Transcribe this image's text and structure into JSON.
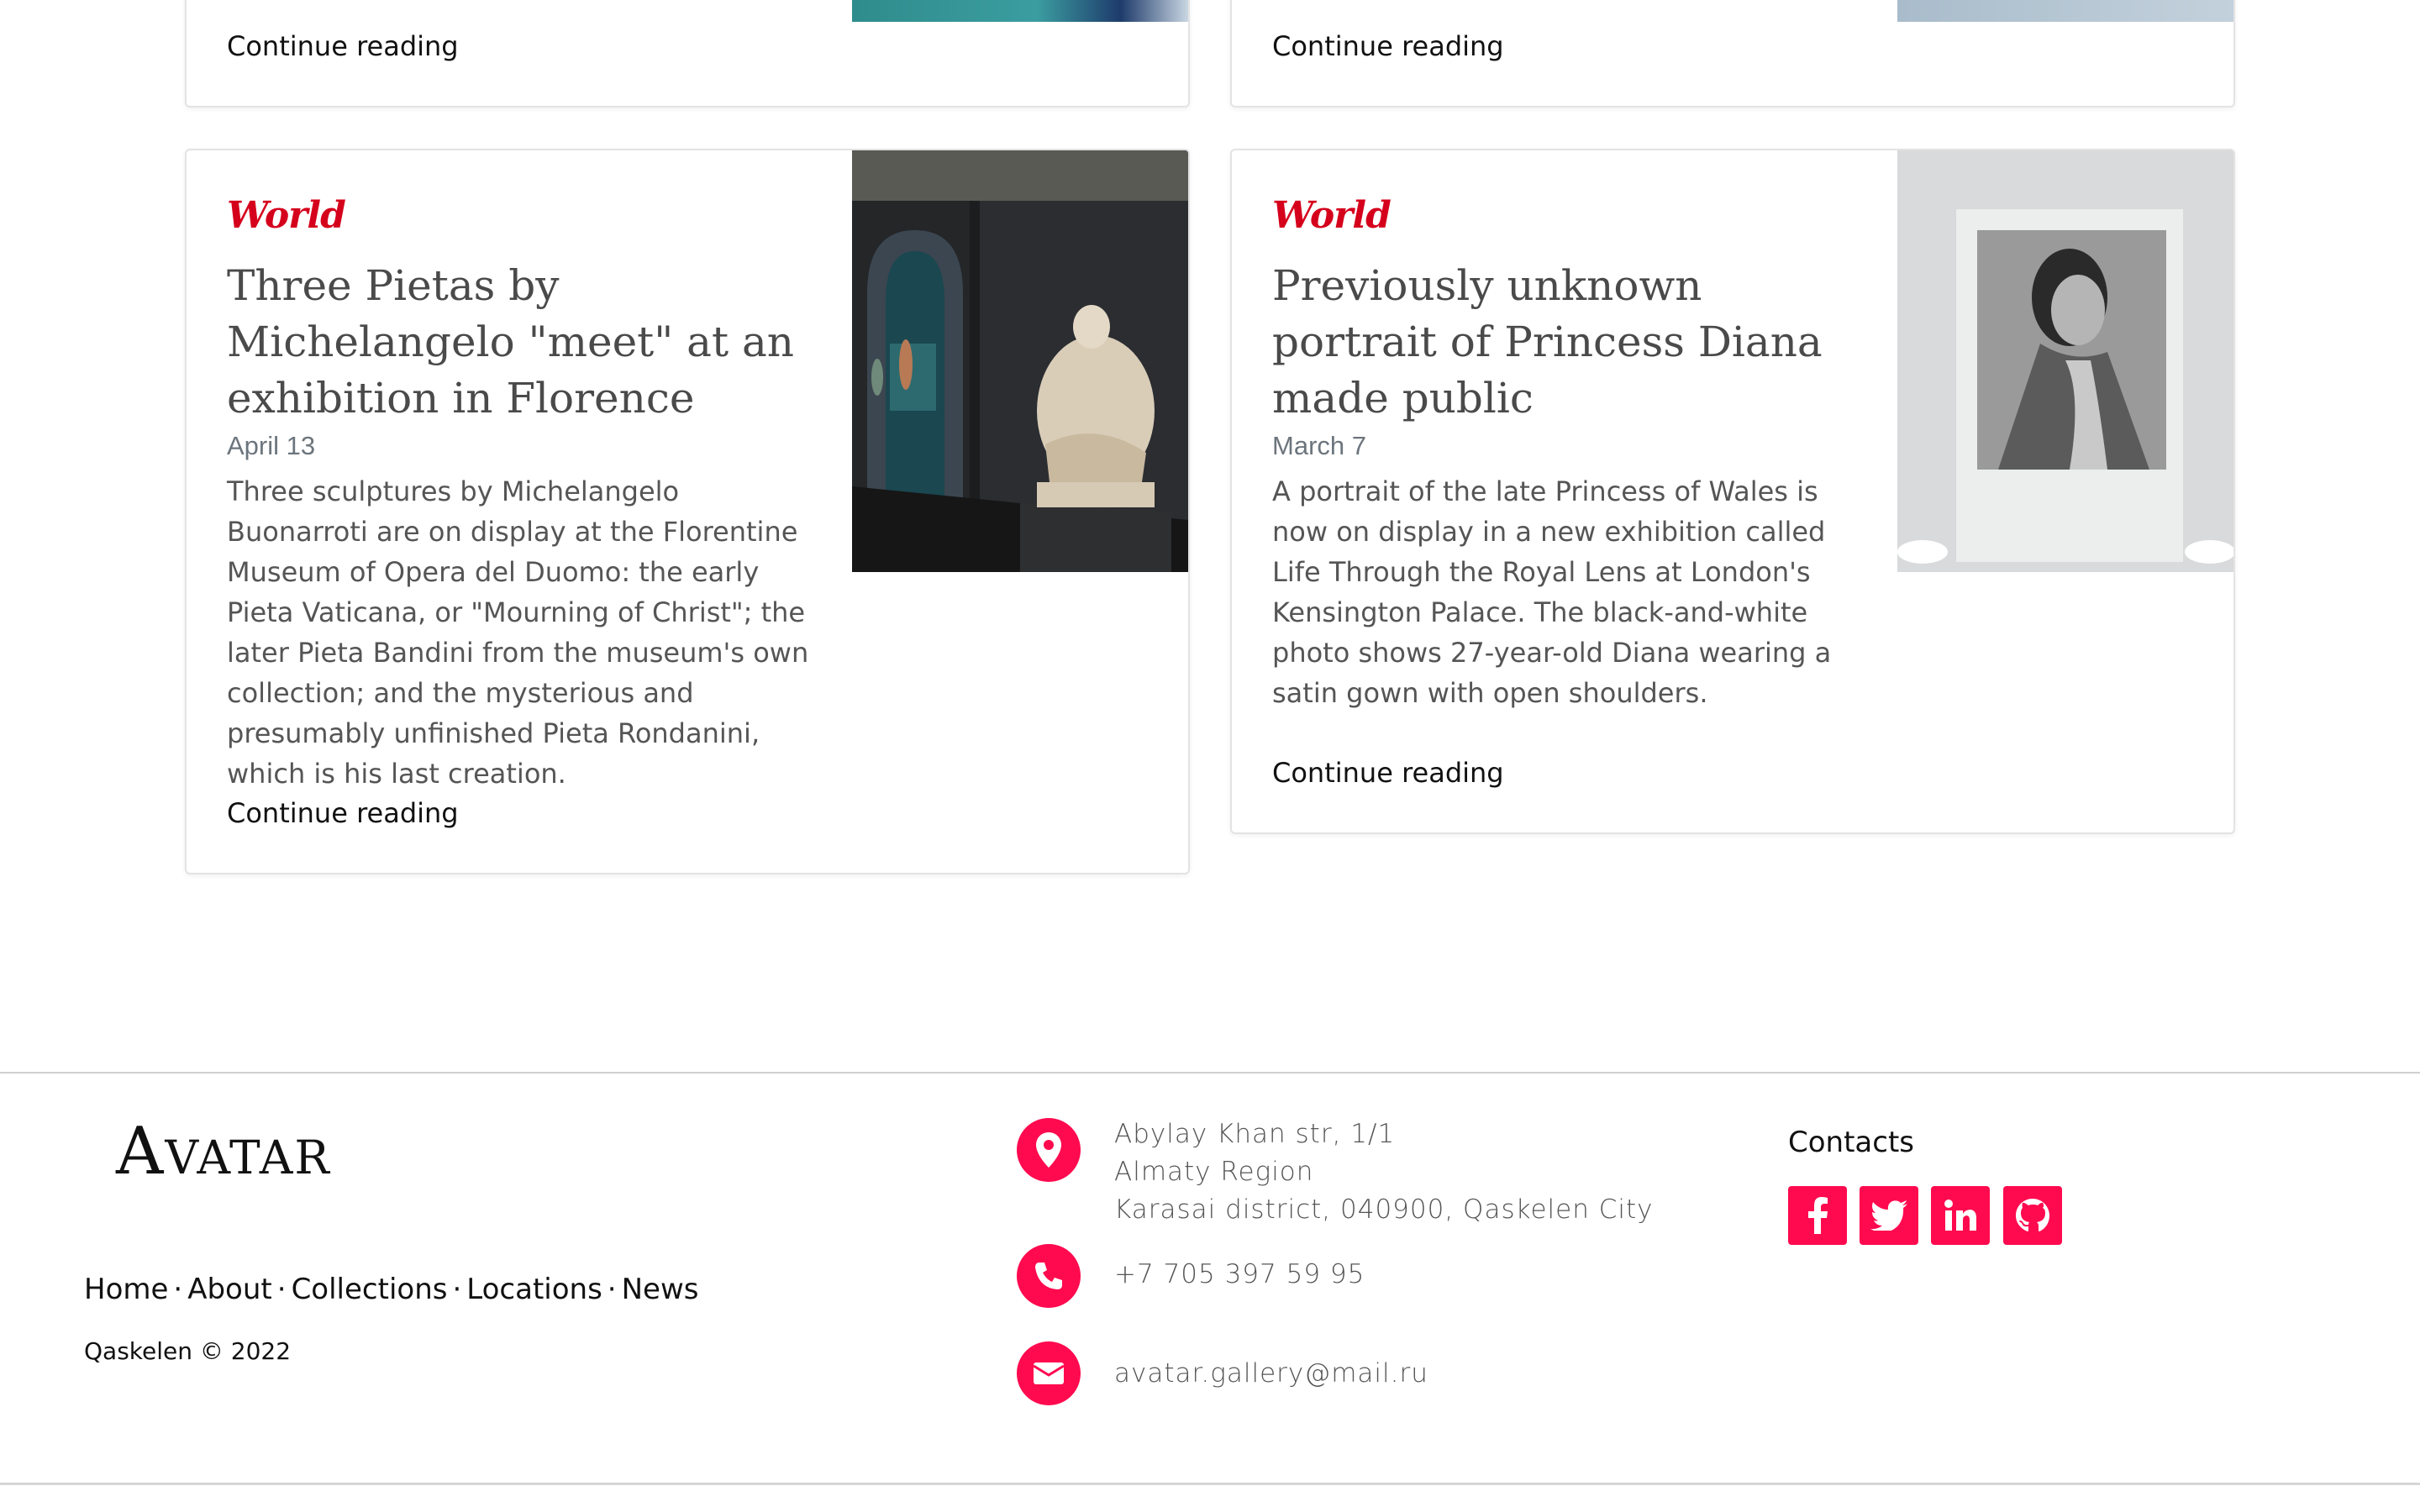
{
  "cards_top": [
    {
      "link": "Continue reading"
    },
    {
      "link": "Continue reading"
    }
  ],
  "cards": [
    {
      "category": "World",
      "title": "Three Pietas by Michelangelo \"meet\" at an exhibition in Florence",
      "date": "April 13",
      "excerpt": "Three sculptures by Michelangelo Buonarroti are on display at the Florentine Museum of Opera del Duomo: the early Pieta Vaticana, or \"Mourning of Christ\"; the later Pieta Bandini from the museum's own collection; and the mysterious and presumably unfinished Pieta Rondanini, which is his last creation.",
      "link": "Continue reading"
    },
    {
      "category": "World",
      "title": "Previously unknown portrait of Princess Diana made public",
      "date": "March 7",
      "excerpt": "A portrait of the late Princess of Wales is now on display in a new exhibition called Life Through the Royal Lens at London's Kensington Palace. The black-and-white photo shows 27-year-old Diana wearing a satin gown with open shoulders.",
      "link": "Continue reading"
    }
  ],
  "footer": {
    "brand": "Avatar",
    "nav": [
      "Home",
      "About",
      "Collections",
      "Locations",
      "News"
    ],
    "separator": "·",
    "copyright": "Qaskelen © 2022",
    "address": [
      "Abylay Khan str, 1/1",
      "Almaty Region",
      "Karasai district, 040900, Qaskelen City"
    ],
    "phone": "+7 705 397 59 95",
    "email": "avatar.gallery@mail.ru",
    "contacts_title": "Contacts",
    "social_icons": [
      "facebook-icon",
      "twitter-icon",
      "linkedin-icon",
      "github-icon"
    ]
  },
  "colors": {
    "accent": "#ff0a4f",
    "category": "#d5001c"
  }
}
